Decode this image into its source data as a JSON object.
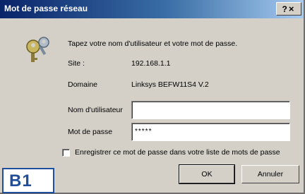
{
  "window": {
    "title": "Mot de passe réseau",
    "help_label": "?",
    "close_label": "×"
  },
  "prompt": "Tapez votre nom d'utilisateur et votre mot de passe.",
  "site": {
    "label": "Site :",
    "value": "192.168.1.1"
  },
  "domain": {
    "label": "Domaine",
    "value": "Linksys BEFW11S4 V.2"
  },
  "username": {
    "label": "Nom d'utilisateur",
    "value": ""
  },
  "password": {
    "label": "Mot de passe",
    "value": "*****"
  },
  "save_password": {
    "label": "Enregistrer ce mot de passe dans votre liste de mots de passe",
    "checked": false
  },
  "buttons": {
    "ok": "OK",
    "cancel": "Annuler"
  },
  "badge": {
    "text": "B1"
  }
}
